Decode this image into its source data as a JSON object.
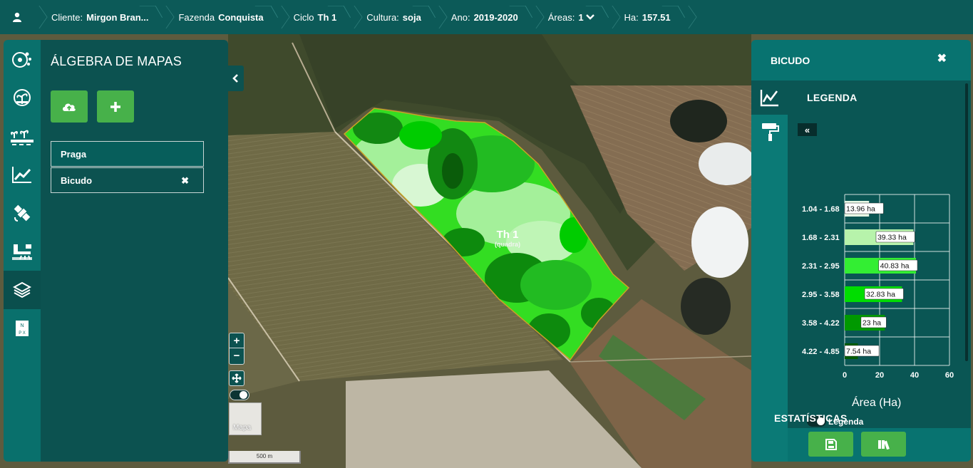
{
  "topbar": {
    "items": [
      {
        "label": "Cliente:",
        "value": "Mirgon Bran..."
      },
      {
        "label": "Fazenda",
        "value": "Conquista"
      },
      {
        "label": "Ciclo",
        "value": "Th 1"
      },
      {
        "label": "Cultura:",
        "value": "soja"
      },
      {
        "label": "Ano:",
        "value": "2019-2020"
      },
      {
        "label": "Áreas:",
        "value": "1"
      },
      {
        "label": "Ha:",
        "value": "157.51"
      }
    ]
  },
  "rail": {
    "icons": [
      "farm-network-icon",
      "plant-globe-icon",
      "sprout-row-icon",
      "line-chart-icon",
      "satellite-icon",
      "sprayer-icon",
      "layers-icon",
      "map-compass-icon"
    ],
    "active_index": 6
  },
  "left_panel": {
    "title": "ÁLGEBRA DE MAPAS",
    "buttons": [
      "cloud-upload-icon",
      "plus-icon"
    ],
    "layers": [
      {
        "label": "Praga"
      },
      {
        "label": "Bicudo",
        "close": "✖"
      }
    ]
  },
  "map": {
    "field_label": "Th 1",
    "field_sublabel": "(quadra)",
    "base_layer": "Mapa",
    "scale": "500 m"
  },
  "right_panel": {
    "title": "BICUDO",
    "close": "✖",
    "section_title": "LEGENDA",
    "collapse_label": "«",
    "toggle_label": "Legenda",
    "stats_title": "ESTATÍSTICAS"
  },
  "chart_data": {
    "type": "bar",
    "orientation": "horizontal",
    "categories": [
      "1.04 - 1.68",
      "1.68 - 2.31",
      "2.31 - 2.95",
      "2.95 - 3.58",
      "3.58 - 4.22",
      "4.22 - 4.85"
    ],
    "values": [
      13.96,
      39.33,
      40.83,
      32.83,
      23,
      7.54
    ],
    "data_labels": [
      "13.96 ha",
      "39.33 ha",
      "40.83 ha",
      "32.83 ha",
      "23 ha",
      "7.54 ha"
    ],
    "colors": [
      "#e6f7e4",
      "#b7f3ab",
      "#33ee33",
      "#00dd00",
      "#009900",
      "#005c00"
    ],
    "xlabel": "Área (Ha)",
    "ylabel": "",
    "xlim": [
      0,
      60
    ],
    "xticks": [
      0,
      20,
      40,
      60
    ],
    "grid": true
  },
  "colors": {
    "topbar": "#0c5a58",
    "panel": "#0c5250",
    "accent_button": "#47b14a"
  }
}
